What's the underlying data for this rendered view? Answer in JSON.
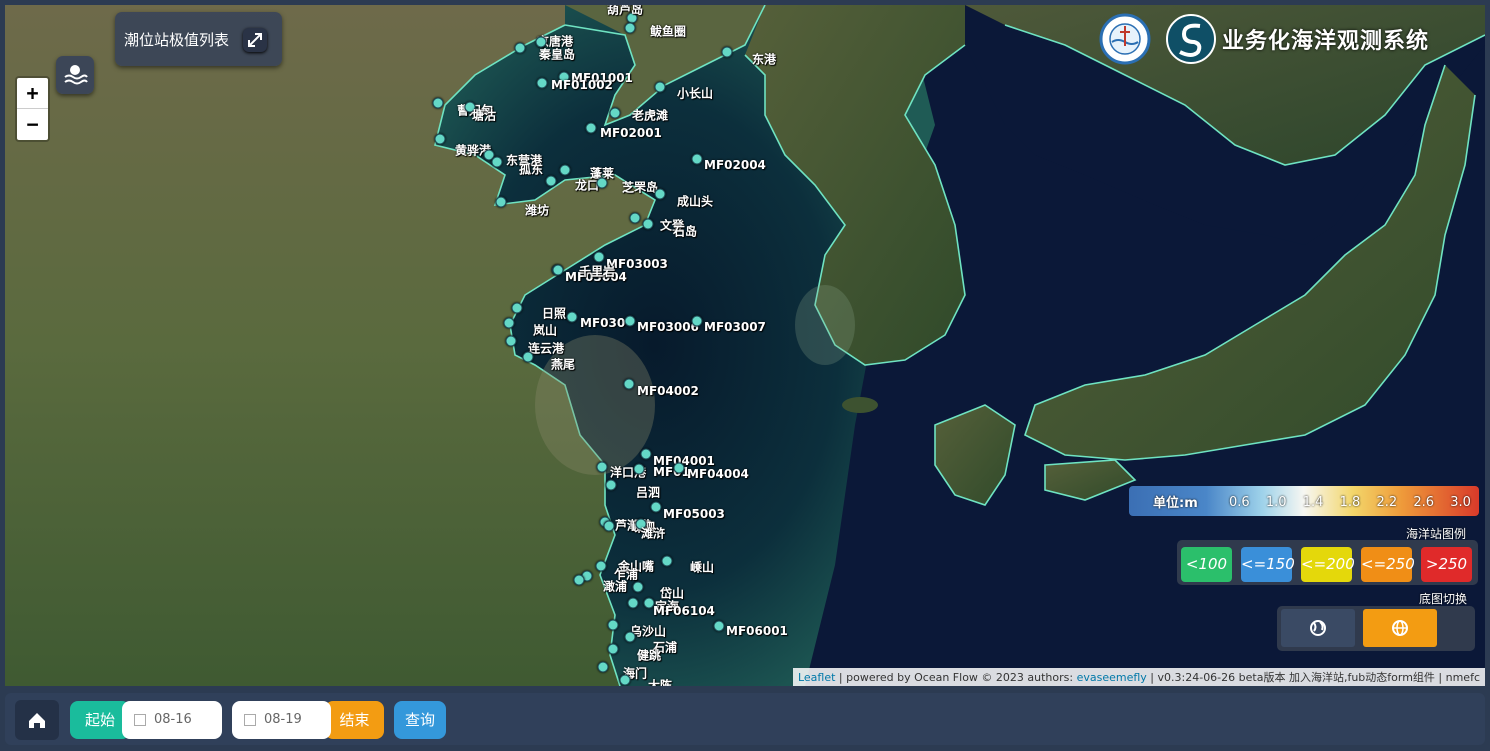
{
  "app": {
    "title": "业务化海洋观测系统",
    "panel_title": "潮位站极值列表"
  },
  "icons": {
    "expand": "expand-arrows-icon",
    "wave": "wave-layer-icon",
    "logo_seal": "ocean-agency-seal-icon",
    "logo_brand": "brand-s-logo-icon",
    "home": "home-icon",
    "calendar": "calendar-icon",
    "globe_dark": "globe-dark-icon",
    "globe": "globe-icon"
  },
  "zoom": {
    "in": "+",
    "out": "−"
  },
  "legend": {
    "unit": "单位:m",
    "ticks": [
      "0.6",
      "1.0",
      "1.4",
      "1.8",
      "2.2",
      "2.6",
      "3.0"
    ],
    "station_legend_title": "海洋站图例",
    "station_levels": [
      {
        "label": "<100",
        "color": "#2bbf6b"
      },
      {
        "label": "<=150",
        "color": "#3a8fd9"
      },
      {
        "label": "<=200",
        "color": "#e4d80b"
      },
      {
        "label": "<=250",
        "color": "#f08e16"
      },
      {
        "label": ">250",
        "color": "#e02a2a"
      }
    ],
    "basemap_title": "底图切换",
    "basemap_colors": {
      "dark": "#3a4a64",
      "active": "#f39c12"
    }
  },
  "attribution": {
    "leaflet": "Leaflet",
    "text1": " | powered by Ocean Flow © 2023 authors: ",
    "author": "evaseemefly",
    "text2": " | v0.3:24-06-26 beta版本 加入海洋站,fub动态form组件 | nmefc"
  },
  "stations": [
    {
      "name": "葫芦岛"
    },
    {
      "name": "鲅鱼圈"
    },
    {
      "name": "东港"
    },
    {
      "name": "京唐港"
    },
    {
      "name": "秦皇岛"
    },
    {
      "name": "MF01001"
    },
    {
      "name": "MF01002"
    },
    {
      "name": "小长山"
    },
    {
      "name": "曹妃甸"
    },
    {
      "name": "塘沽"
    },
    {
      "name": "老虎滩"
    },
    {
      "name": "MF02001"
    },
    {
      "name": "黄骅港"
    },
    {
      "name": "东营港"
    },
    {
      "name": "孤东"
    },
    {
      "name": "蓬莱"
    },
    {
      "name": "龙口"
    },
    {
      "name": "芝罘岛"
    },
    {
      "name": "MF02004"
    },
    {
      "name": "成山头"
    },
    {
      "name": "潍坊"
    },
    {
      "name": "文登"
    },
    {
      "name": "石岛"
    },
    {
      "name": "MF03003"
    },
    {
      "name": "MF03004"
    },
    {
      "name": "千里岩"
    },
    {
      "name": "日照"
    },
    {
      "name": "MF030"
    },
    {
      "name": "MF03006"
    },
    {
      "name": "MF03007"
    },
    {
      "name": "岚山"
    },
    {
      "name": "连云港"
    },
    {
      "name": "燕尾"
    },
    {
      "name": "MF04002"
    },
    {
      "name": "MF04001"
    },
    {
      "name": "洋口港"
    },
    {
      "name": "MF01"
    },
    {
      "name": "MF04004"
    },
    {
      "name": "吕泗"
    },
    {
      "name": "MF05003"
    },
    {
      "name": "芦潮港"
    },
    {
      "name": "嵊泗"
    },
    {
      "name": "滩浒"
    },
    {
      "name": "嵊山"
    },
    {
      "name": "金山嘴"
    },
    {
      "name": "乍浦"
    },
    {
      "name": "澉浦"
    },
    {
      "name": "岱山"
    },
    {
      "name": "定海"
    },
    {
      "name": "MF06104"
    },
    {
      "name": "乌沙山"
    },
    {
      "name": "石浦"
    },
    {
      "name": "MF06001"
    },
    {
      "name": "健跳"
    },
    {
      "name": "海门"
    },
    {
      "name": "大陈"
    }
  ],
  "bottom": {
    "start_label": "起始",
    "start_date": "08-16",
    "end_date": "08-19",
    "end_label": "结束",
    "query_label": "查询",
    "colors": {
      "start": "#1abc9c",
      "end": "#f39c12",
      "query": "#3498db"
    }
  }
}
